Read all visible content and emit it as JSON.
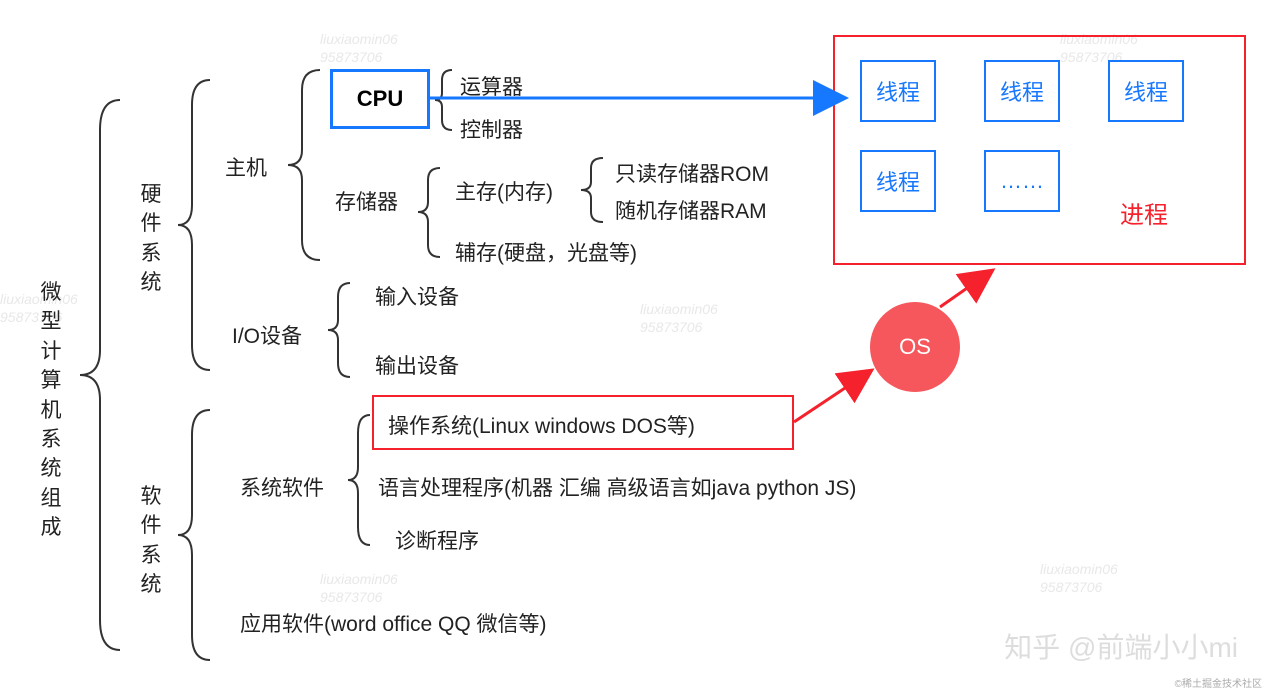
{
  "root": "微型计算机系统组成",
  "hardware": {
    "label": "硬件系统",
    "host": {
      "label": "主机",
      "cpu": {
        "label": "CPU",
        "alu": "运算器",
        "cu": "控制器"
      },
      "memory": {
        "label": "存储器",
        "main": {
          "label": "主存(内存)",
          "rom": "只读存储器ROM",
          "ram": "随机存储器RAM"
        },
        "aux": "辅存(硬盘，光盘等)"
      }
    },
    "io": {
      "label": "I/O设备",
      "input": "输入设备",
      "output": "输出设备"
    }
  },
  "software": {
    "label": "软件系统",
    "system": {
      "label": "系统软件",
      "os": "操作系统(Linux windows DOS等)",
      "lang": "语言处理程序(机器 汇编 高级语言如java python JS)",
      "diag": "诊断程序"
    },
    "app": "应用软件(word office QQ 微信等)"
  },
  "process_panel": {
    "thread": "线程",
    "ellipsis": "……",
    "process": "进程",
    "os": "OS"
  },
  "watermark": {
    "line1": "liuxiaomin06",
    "line2": "95873706"
  },
  "attribution": "知乎 @前端小小mi",
  "corner": "©稀土掘金技术社区"
}
